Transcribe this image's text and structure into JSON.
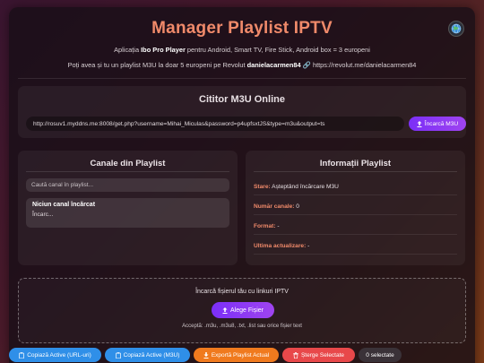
{
  "header": {
    "title": "Manager Playlist IPTV",
    "subtitle_prefix": "Aplicația",
    "subtitle_app": "Ibo Pro Player",
    "subtitle_rest": "pentru Android, Smart TV, Fire Stick, Android box = 3 europeni",
    "promo_prefix": "Poți avea și tu un playlist M3U la doar 5 europeni pe Revolut",
    "promo_user": "danielacarmen84",
    "promo_link": "https://revolut.me/danielacarmen84"
  },
  "reader": {
    "title": "Cititor M3U Online",
    "url_value": "http://rosuv1.myddns.me:8008/get.php?username=Mihai_Miculas&password=p4upfsxtJS&type=m3u&output=ts",
    "load_label": "Încarcă M3U"
  },
  "channels": {
    "title": "Canale din Playlist",
    "search_placeholder": "Caută canal în playlist...",
    "empty_title": "Niciun canal încărcat",
    "empty_status": "Încarc..."
  },
  "info": {
    "title": "Informații Playlist",
    "rows": [
      {
        "label": "Stare:",
        "value": "Așteptând încărcare M3U"
      },
      {
        "label": "Număr canale:",
        "value": "0"
      },
      {
        "label": "Format:",
        "value": "-"
      },
      {
        "label": "Ultima actualizare:",
        "value": "-"
      }
    ]
  },
  "upload": {
    "title": "Încarcă fișierul tău cu linkuri IPTV",
    "button_label": "Alege Fișier",
    "hint": "Acceptă: .m3u, .m3u8, .txt, .list sau orice fișier text"
  },
  "actions": {
    "copy_url": "Copiază Active (URL-uri)",
    "copy_m3u": "Copiază Active (M3U)",
    "export": "Exportă Playlist Actual",
    "delete": "Șterge Selectate",
    "selected": "0 selectate"
  },
  "colors": {
    "accent": "#f08a6a",
    "primary_button": "#7b2ff7",
    "blue_button": "#2f8fe8",
    "orange_button": "#f07a1e",
    "red_button": "#e8484a"
  },
  "icons": {
    "language": "globe-icon",
    "upload": "upload-icon",
    "copy": "clipboard-icon",
    "export": "download-icon",
    "delete": "trash-icon",
    "link": "link-icon"
  }
}
